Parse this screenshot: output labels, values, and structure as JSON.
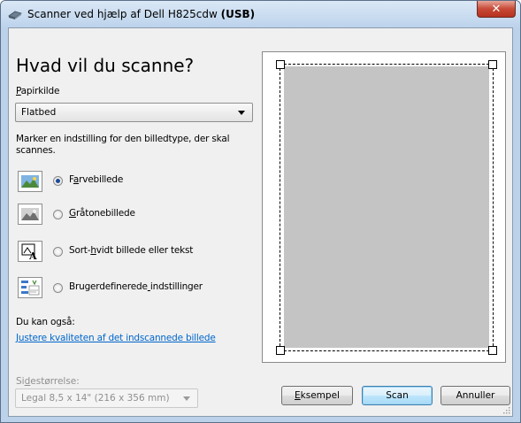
{
  "window": {
    "title_prefix": "Scanner ved hjælp af Dell H825cdw",
    "title_bold": "(USB)",
    "close_glyph": "✕"
  },
  "heading": "Hvad vil du scanne?",
  "paper_source": {
    "label": "Papirkilde",
    "value": "Flatbed"
  },
  "instruction": "Marker en indstilling for den billedtype, der skal scannes.",
  "image_types": [
    {
      "label": "Farvebillede",
      "selected": true,
      "icon": "color-photo-icon"
    },
    {
      "label": "Gråtonebillede",
      "selected": false,
      "icon": "grayscale-photo-icon"
    },
    {
      "label": "Sort-hvidt billede eller tekst",
      "selected": false,
      "icon": "black-white-text-icon"
    },
    {
      "label": "Brugerdefinerede indstillinger",
      "selected": false,
      "icon": "custom-settings-icon"
    }
  ],
  "also": {
    "label": "Du kan også:",
    "link": "Justere kvaliteten af det indscannede billede"
  },
  "page_size": {
    "label": "Sidestørrelse:",
    "value": "Legal 8,5 x 14\" (216 x 356 mm)"
  },
  "buttons": {
    "preview": "Eksempel",
    "scan": "Scan",
    "cancel": "Annuller"
  },
  "colors": {
    "link": "#0066cc",
    "scan_area": "#c4c4c4",
    "close_button": "#c74a36"
  }
}
